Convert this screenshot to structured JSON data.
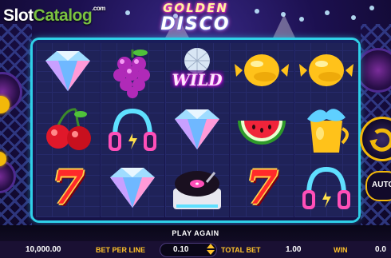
{
  "site_logo": {
    "slot": "Slot",
    "catalog": "Catalog",
    "tld": ".com"
  },
  "game_logo": {
    "line1": "GOLDEN",
    "line2": "DISCO"
  },
  "reels": [
    [
      "diamond-icon",
      "cherries-icon",
      "seven-icon"
    ],
    [
      "grapes-icon",
      "headphones-icon",
      "diamond-icon"
    ],
    [
      "wild-icon",
      "diamond-icon",
      "turntable-icon"
    ],
    [
      "lemon-icon",
      "watermelon-icon",
      "seven-icon"
    ],
    [
      "lemon-icon",
      "splash-cup-icon",
      "headphones-icon"
    ]
  ],
  "wild_label": "WILD",
  "seven_label": "7",
  "side_buttons": {
    "auto_label": "AUTO"
  },
  "status": {
    "play_again": "PLAY AGAIN"
  },
  "bottom_bar": {
    "balance": "10,000.00",
    "bet_per_line_label": "BET PER LINE",
    "bet_per_line_value": "0.10",
    "total_bet_label": "TOTAL BET",
    "total_bet_value": "1.00",
    "win_label": "WIN",
    "win_value": "0.0"
  },
  "colors": {
    "frame": "#2fd0e8",
    "label_gold": "#ffc32a",
    "bg": "#1c1050"
  }
}
